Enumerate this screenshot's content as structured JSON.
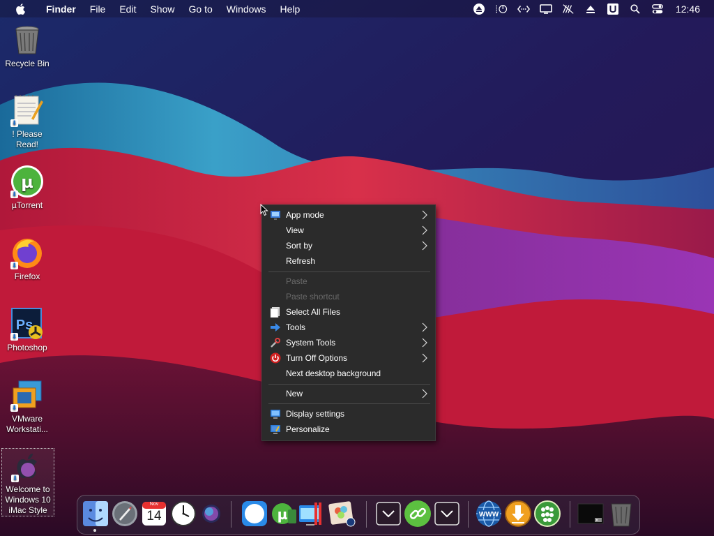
{
  "menubar": {
    "app_name": "Finder",
    "items": [
      "File",
      "Edit",
      "Show",
      "Go to",
      "Windows",
      "Help"
    ],
    "clock": "12:46",
    "status_icons": [
      "eject-icon",
      "cpu-gauge-icon",
      "network-code-icon",
      "display-icon",
      "mute-icon",
      "upload-icon",
      "u-icon",
      "search-icon",
      "control-center-icon"
    ]
  },
  "desktop": {
    "icons": [
      {
        "label": "Recycle Bin",
        "icon": "trash-icon"
      },
      {
        "label": "! Please Read!",
        "icon": "notepad-icon"
      },
      {
        "label": "µTorrent",
        "icon": "utorrent-icon"
      },
      {
        "label": "Firefox",
        "icon": "firefox-icon"
      },
      {
        "label": "Photoshop",
        "icon": "photoshop-icon"
      },
      {
        "label": "VMware Workstati...",
        "icon": "vmware-icon"
      },
      {
        "label": "Welcome to Windows 10 iMac Style",
        "icon": "apple-logo-icon"
      }
    ]
  },
  "context_menu": {
    "items": [
      {
        "label": "App mode",
        "submenu": true,
        "icon": "app-mode-icon"
      },
      {
        "label": "View",
        "submenu": true
      },
      {
        "label": "Sort by",
        "submenu": true
      },
      {
        "label": "Refresh"
      },
      {
        "label": "Paste",
        "disabled": true
      },
      {
        "label": "Paste shortcut",
        "disabled": true
      },
      {
        "label": "Select All Files",
        "icon": "select-files-icon"
      },
      {
        "label": "Tools",
        "submenu": true,
        "icon": "tools-arrow-icon"
      },
      {
        "label": "System Tools",
        "submenu": true,
        "icon": "system-tools-icon"
      },
      {
        "label": "Turn Off Options",
        "submenu": true,
        "icon": "power-icon"
      },
      {
        "label": "Next desktop background"
      },
      {
        "label": "New",
        "submenu": true
      },
      {
        "label": "Display settings",
        "icon": "display-settings-icon"
      },
      {
        "label": "Personalize",
        "icon": "personalize-icon"
      }
    ]
  },
  "dock": {
    "calendar_month": "Nov",
    "calendar_day": "14",
    "items": [
      "finder-icon",
      "launchpad-icon",
      "calendar-icon",
      "clock-icon",
      "siri-icon",
      "safari-icon",
      "utorrent-icon",
      "folder-icon",
      "system-monitor-icon",
      "photos-icon",
      "chevron-down-icon",
      "link-icon",
      "chevron-down-icon",
      "www-icon",
      "download-icon",
      "dots-app-icon",
      "terminal-icon",
      "trash-icon"
    ]
  },
  "colors": {
    "menu_bg": "#2b2b2b",
    "menu_text": "#ffffff",
    "menu_disabled": "#6a6a6a"
  }
}
